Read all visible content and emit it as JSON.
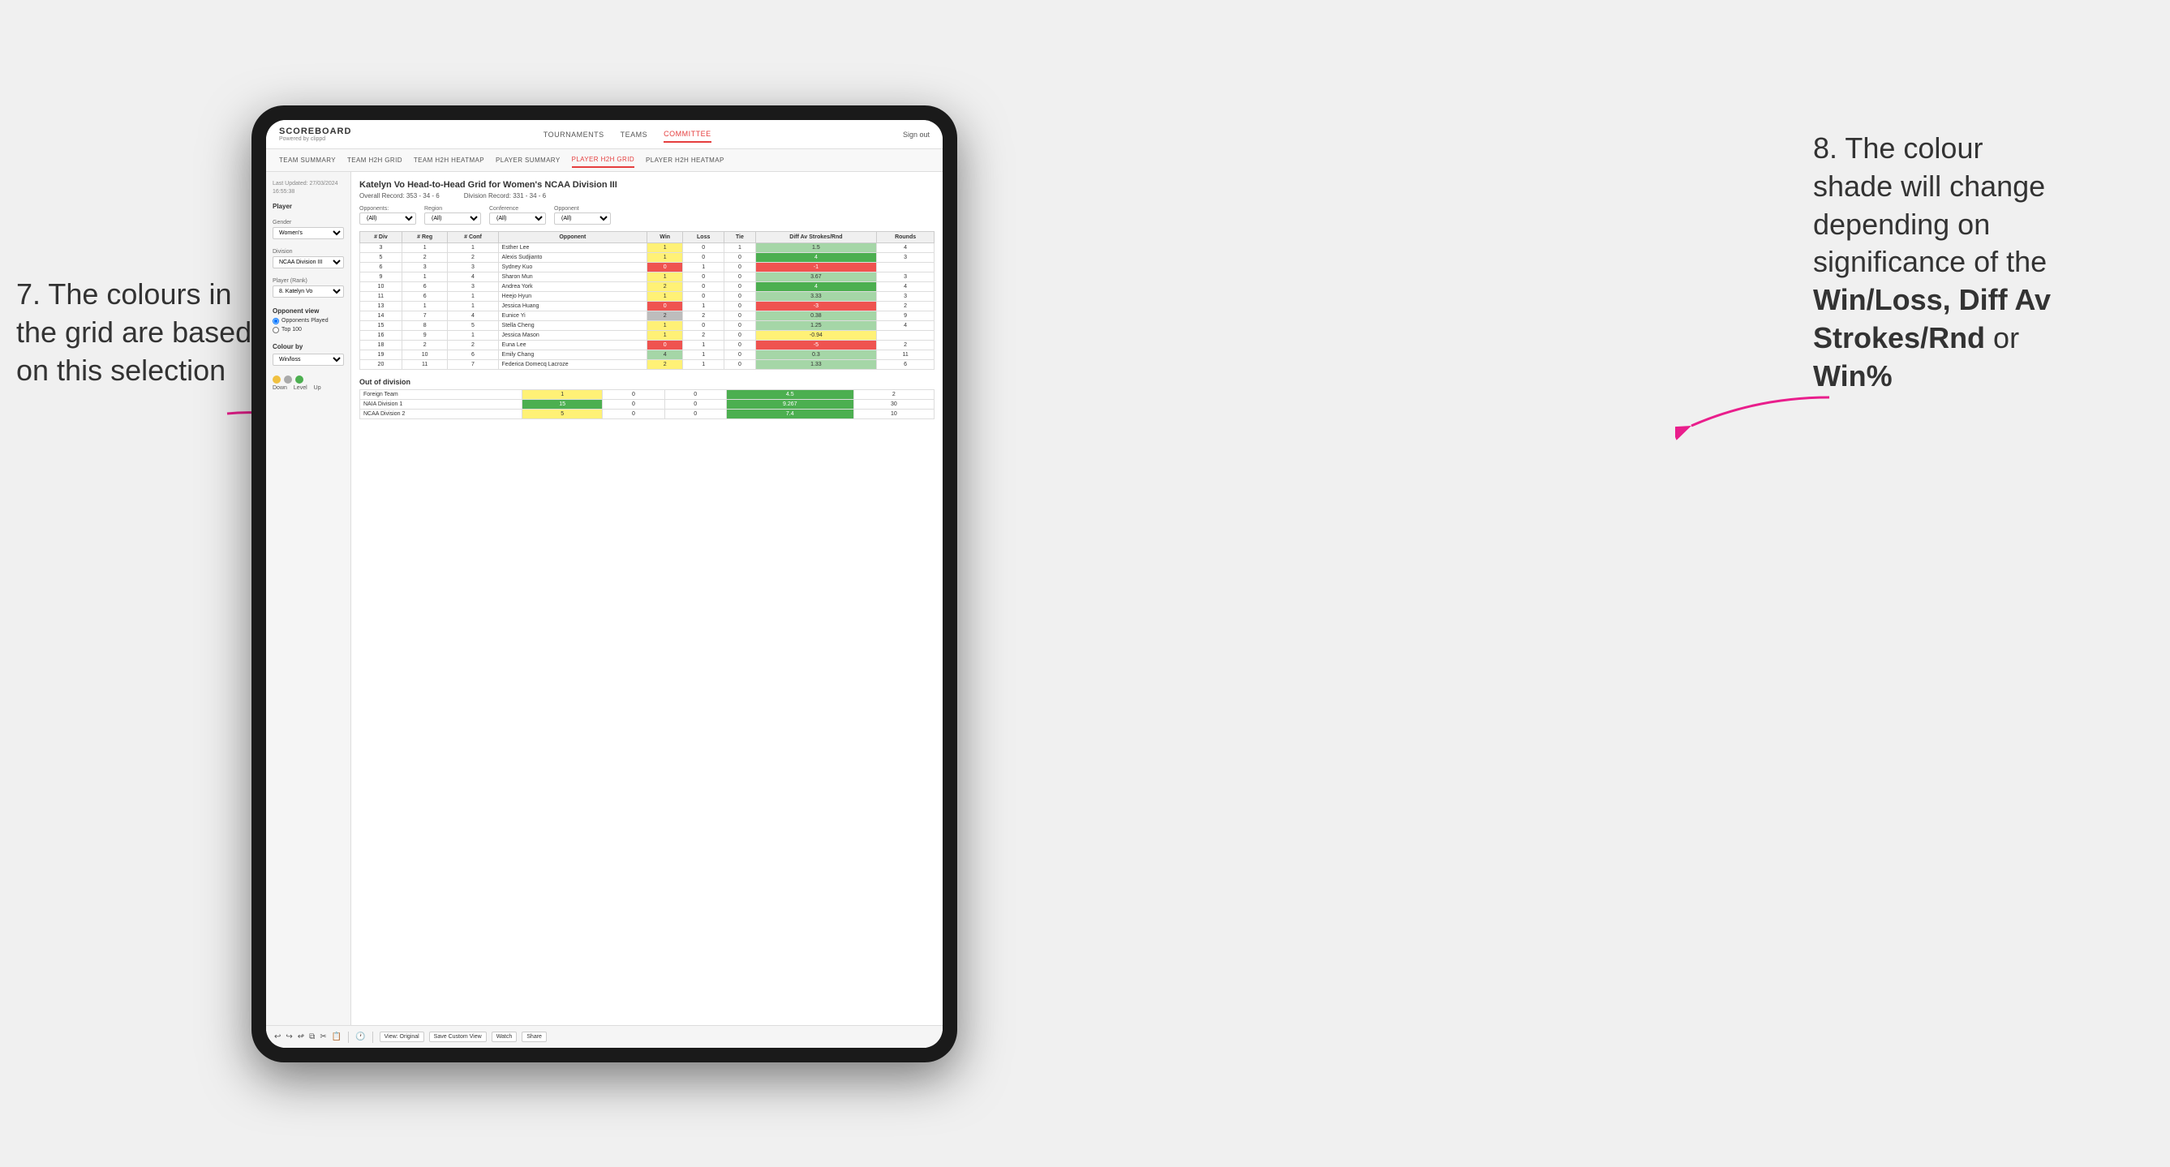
{
  "app": {
    "logo": "SCOREBOARD",
    "logo_sub": "Powered by clippd",
    "sign_out": "Sign out",
    "nav": [
      "TOURNAMENTS",
      "TEAMS",
      "COMMITTEE"
    ],
    "active_nav": "COMMITTEE",
    "sub_nav": [
      "TEAM SUMMARY",
      "TEAM H2H GRID",
      "TEAM H2H HEATMAP",
      "PLAYER SUMMARY",
      "PLAYER H2H GRID",
      "PLAYER H2H HEATMAP"
    ],
    "active_sub_nav": "PLAYER H2H GRID"
  },
  "sidebar": {
    "last_updated_label": "Last Updated: 27/03/2024",
    "last_updated_time": "16:55:38",
    "player_label": "Player",
    "gender_label": "Gender",
    "gender_value": "Women's",
    "division_label": "Division",
    "division_value": "NCAA Division III",
    "player_rank_label": "Player (Rank)",
    "player_rank_value": "8. Katelyn Vo",
    "opponent_view_label": "Opponent view",
    "radio_options": [
      "Opponents Played",
      "Top 100"
    ],
    "radio_selected": "Opponents Played",
    "colour_by_label": "Colour by",
    "colour_by_value": "Win/loss",
    "legend": {
      "down": "Down",
      "level": "Level",
      "up": "Up"
    }
  },
  "grid": {
    "title": "Katelyn Vo Head-to-Head Grid for Women's NCAA Division III",
    "overall_record_label": "Overall Record:",
    "overall_record_value": "353 - 34 - 6",
    "division_record_label": "Division Record:",
    "division_record_value": "331 - 34 - 6",
    "opponents_label": "Opponents:",
    "opponents_filter": "(All)",
    "region_label": "Region",
    "region_filter": "(All)",
    "conference_label": "Conference",
    "conference_filter": "(All)",
    "opponent_label": "Opponent",
    "opponent_filter": "(All)",
    "table_headers": {
      "div": "# Div",
      "reg": "# Reg",
      "conf": "# Conf",
      "opponent": "Opponent",
      "win": "Win",
      "loss": "Loss",
      "tie": "Tie",
      "diff_av": "Diff Av Strokes/Rnd",
      "rounds": "Rounds"
    },
    "rows": [
      {
        "div": 3,
        "reg": 1,
        "conf": 1,
        "opponent": "Esther Lee",
        "win": 1,
        "loss": 0,
        "tie": 1,
        "diff_av": 1.5,
        "rounds": 4,
        "win_color": "yellow",
        "diff_color": "green-light"
      },
      {
        "div": 5,
        "reg": 2,
        "conf": 2,
        "opponent": "Alexis Sudjianto",
        "win": 1,
        "loss": 0,
        "tie": 0,
        "diff_av": 4.0,
        "rounds": 3,
        "win_color": "yellow",
        "diff_color": "green"
      },
      {
        "div": 6,
        "reg": 3,
        "conf": 3,
        "opponent": "Sydney Kuo",
        "win": 0,
        "loss": 1,
        "tie": 0,
        "diff_av": -1.0,
        "rounds": "",
        "win_color": "red",
        "diff_color": "red"
      },
      {
        "div": 9,
        "reg": 1,
        "conf": 4,
        "opponent": "Sharon Mun",
        "win": 1,
        "loss": 0,
        "tie": 0,
        "diff_av": 3.67,
        "rounds": 3,
        "win_color": "yellow",
        "diff_color": "green-light"
      },
      {
        "div": 10,
        "reg": 6,
        "conf": 3,
        "opponent": "Andrea York",
        "win": 2,
        "loss": 0,
        "tie": 0,
        "diff_av": 4.0,
        "rounds": 4,
        "win_color": "yellow",
        "diff_color": "green"
      },
      {
        "div": 11,
        "reg": 6,
        "conf": 1,
        "opponent": "Heejo Hyun",
        "win": 1,
        "loss": 0,
        "tie": 0,
        "diff_av": 3.33,
        "rounds": 3,
        "win_color": "yellow",
        "diff_color": "green-light"
      },
      {
        "div": 13,
        "reg": 1,
        "conf": 1,
        "opponent": "Jessica Huang",
        "win": 0,
        "loss": 1,
        "tie": 0,
        "diff_av": -3.0,
        "rounds": 2,
        "win_color": "red",
        "diff_color": "red"
      },
      {
        "div": 14,
        "reg": 7,
        "conf": 4,
        "opponent": "Eunice Yi",
        "win": 2,
        "loss": 2,
        "tie": 0,
        "diff_av": 0.38,
        "rounds": 9,
        "win_color": "gray",
        "diff_color": "green-light"
      },
      {
        "div": 15,
        "reg": 8,
        "conf": 5,
        "opponent": "Stella Cheng",
        "win": 1,
        "loss": 0,
        "tie": 0,
        "diff_av": 1.25,
        "rounds": 4,
        "win_color": "yellow",
        "diff_color": "green-light"
      },
      {
        "div": 16,
        "reg": 9,
        "conf": 1,
        "opponent": "Jessica Mason",
        "win": 1,
        "loss": 2,
        "tie": 0,
        "diff_av": -0.94,
        "rounds": "",
        "win_color": "yellow",
        "diff_color": "yellow"
      },
      {
        "div": 18,
        "reg": 2,
        "conf": 2,
        "opponent": "Euna Lee",
        "win": 0,
        "loss": 1,
        "tie": 0,
        "diff_av": -5.0,
        "rounds": 2,
        "win_color": "red",
        "diff_color": "red"
      },
      {
        "div": 19,
        "reg": 10,
        "conf": 6,
        "opponent": "Emily Chang",
        "win": 4,
        "loss": 1,
        "tie": 0,
        "diff_av": 0.3,
        "rounds": 11,
        "win_color": "green-light",
        "diff_color": "green-light"
      },
      {
        "div": 20,
        "reg": 11,
        "conf": 7,
        "opponent": "Federica Domecq Lacroze",
        "win": 2,
        "loss": 1,
        "tie": 0,
        "diff_av": 1.33,
        "rounds": 6,
        "win_color": "yellow",
        "diff_color": "green-light"
      }
    ],
    "out_of_division_label": "Out of division",
    "out_of_division_rows": [
      {
        "opponent": "Foreign Team",
        "win": 1,
        "loss": 0,
        "tie": 0,
        "diff_av": 4.5,
        "rounds": 2,
        "win_color": "yellow",
        "diff_color": "green"
      },
      {
        "opponent": "NAIA Division 1",
        "win": 15,
        "loss": 0,
        "tie": 0,
        "diff_av": 9.267,
        "rounds": 30,
        "win_color": "green",
        "diff_color": "green"
      },
      {
        "opponent": "NCAA Division 2",
        "win": 5,
        "loss": 0,
        "tie": 0,
        "diff_av": 7.4,
        "rounds": 10,
        "win_color": "yellow",
        "diff_color": "green"
      }
    ]
  },
  "toolbar": {
    "buttons": [
      "View: Original",
      "Save Custom View",
      "Watch",
      "Share"
    ],
    "icons": [
      "undo",
      "redo",
      "step-back",
      "copy",
      "cut",
      "paste",
      "clock"
    ]
  },
  "annotations": {
    "left": {
      "line1": "7. The colours in",
      "line2": "the grid are based",
      "line3": "on this selection"
    },
    "right": {
      "line1": "8. The colour",
      "line2": "shade will change",
      "line3": "depending on",
      "line4": "significance of the",
      "line5_bold": "Win/Loss, Diff Av",
      "line6_bold": "Strokes/Rnd",
      "line6_cont": " or",
      "line7_bold": "Win%"
    }
  }
}
